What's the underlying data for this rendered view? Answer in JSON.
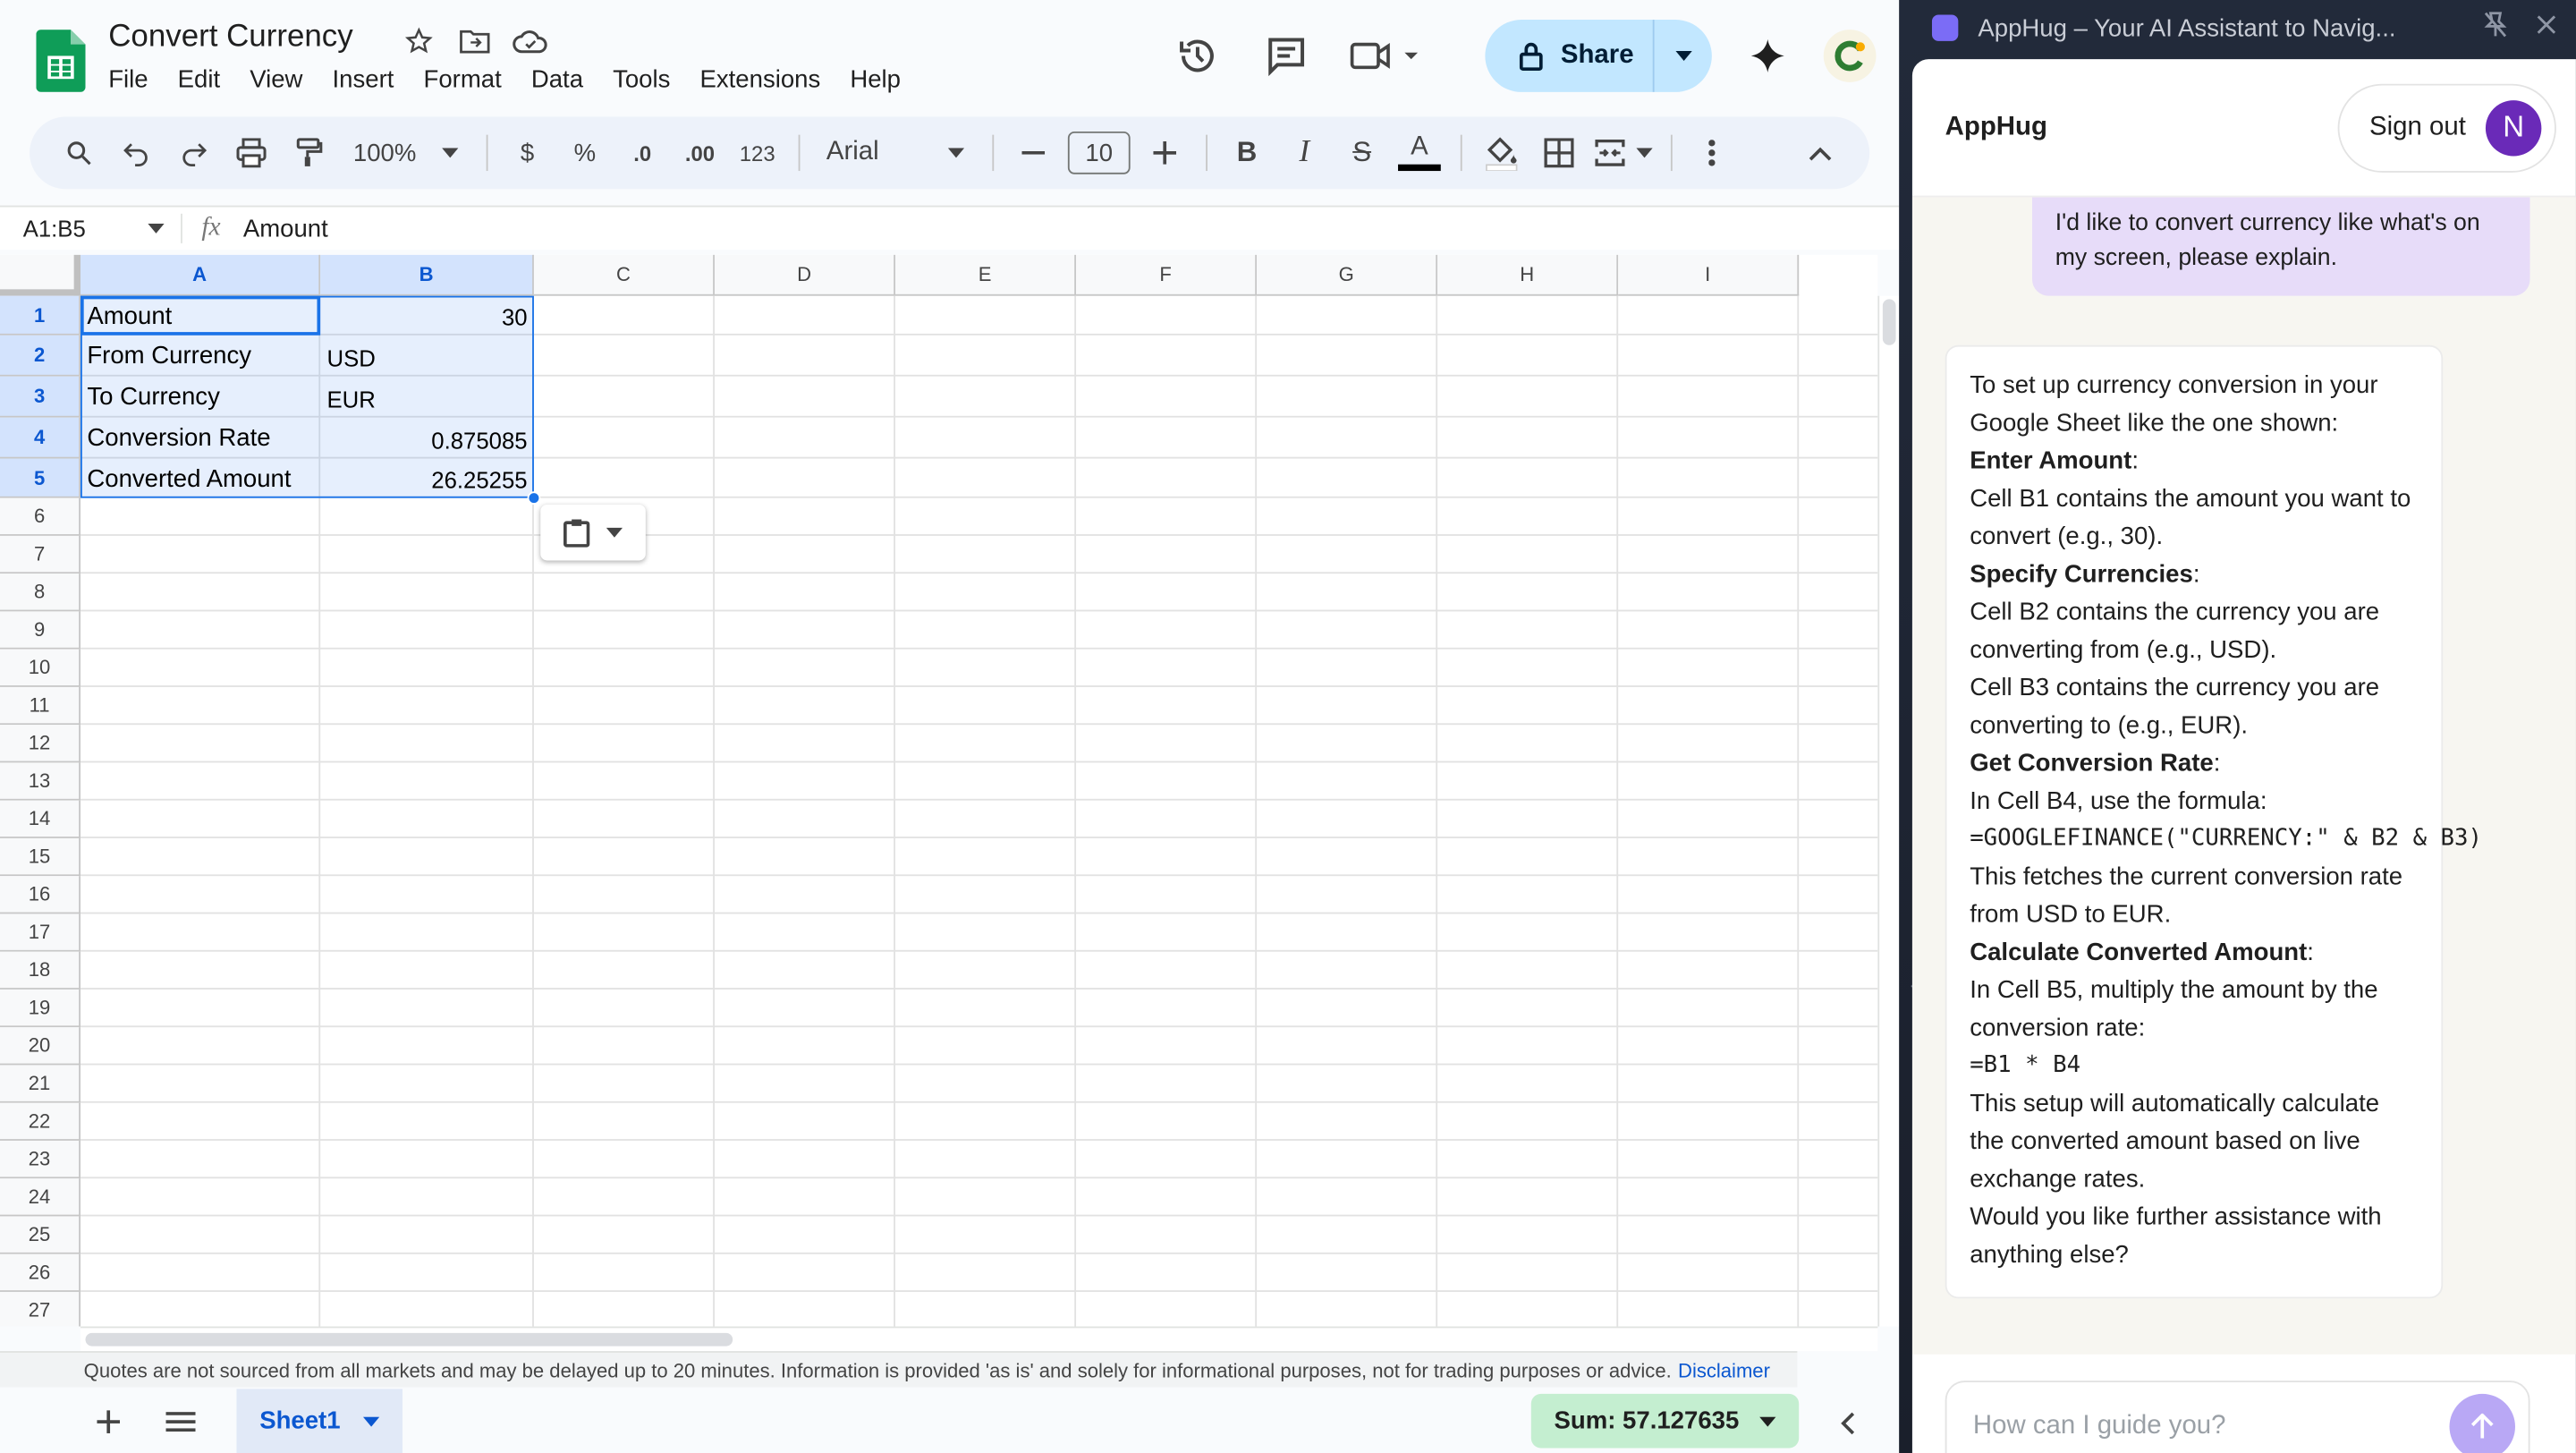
{
  "sheets": {
    "title": "Convert Currency",
    "menu": [
      "File",
      "Edit",
      "View",
      "Insert",
      "Format",
      "Data",
      "Tools",
      "Extensions",
      "Help"
    ],
    "share_label": "Share",
    "toolbar": {
      "zoom": "100%",
      "currency": "$",
      "percent": "%",
      "dec_decrease": ".0",
      "dec_increase": ".00",
      "number_format": "123",
      "font": "Arial",
      "font_size": "10",
      "bold": "B",
      "italic": "I",
      "strike": "S",
      "text_color": "A"
    },
    "name_box": "A1:B5",
    "formula_value": "Amount",
    "columns": [
      "A",
      "B",
      "C",
      "D",
      "E",
      "F",
      "G",
      "H",
      "I"
    ],
    "rows": [
      "1",
      "2",
      "3",
      "4",
      "5",
      "6",
      "7",
      "8",
      "9",
      "10",
      "11",
      "12",
      "13",
      "14",
      "15",
      "16",
      "17",
      "18",
      "19",
      "20",
      "21",
      "22",
      "23",
      "24",
      "25",
      "26",
      "27"
    ],
    "cells": [
      {
        "a": "Amount",
        "b": "30"
      },
      {
        "a": "From Currency",
        "b": "USD"
      },
      {
        "a": "To Currency",
        "b": "EUR"
      },
      {
        "a": "Conversion Rate",
        "b": "0.875085"
      },
      {
        "a": "Converted Amount",
        "b": "26.25255"
      }
    ],
    "disclaimer": "Quotes are not sourced from all markets and may be delayed up to 20 minutes. Information is provided 'as is' and solely for informational purposes, not for trading purposes or advice.",
    "disclaimer_link": "Disclaimer",
    "sheet_tab": "Sheet1",
    "sum": "Sum: 57.127635",
    "colors": {
      "accent": "#1a73e8",
      "share_bg": "#c2e7ff",
      "sum_bg": "#c4eed0"
    }
  },
  "apphug": {
    "window_title": "AppHug – Your AI Assistant to Navig...",
    "brand": "AppHug",
    "sign_out": "Sign out",
    "avatar_letter": "N",
    "user_message": "I'd like to convert currency like what's on my screen, please explain.",
    "bot": {
      "intro": "To set up currency conversion in your Google Sheet like the one shown:",
      "h1": "Enter Amount",
      "p1": "Cell B1 contains the amount you want to convert (e.g., 30).",
      "h2": "Specify Currencies",
      "p2a": "Cell B2 contains the currency you are converting from (e.g., USD).",
      "p2b": "Cell B3 contains the currency you are converting to (e.g., EUR).",
      "h3": "Get Conversion Rate",
      "p3a": "In Cell B4, use the formula:",
      "code1": "=GOOGLEFINANCE(\"CURRENCY:\" & B2 & B3)",
      "p3b": "This fetches the current conversion rate from USD to EUR.",
      "h4": "Calculate Converted Amount",
      "p4a": "In Cell B5, multiply the amount by the conversion rate:",
      "code2": "=B1 * B4",
      "p4b": "This setup will automatically calculate the converted amount based on live exchange rates.",
      "outro": "Would you like further assistance with anything else?"
    },
    "input_placeholder": "How can I guide you?",
    "colors": {
      "user_bubble": "#e7dcf9",
      "avatar": "#6a2ab8",
      "send": "#b9a8f5"
    }
  }
}
